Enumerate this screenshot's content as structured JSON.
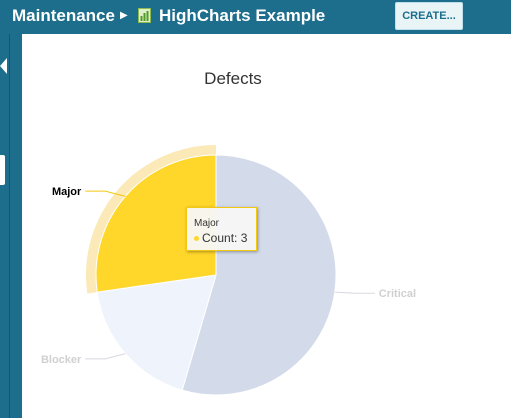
{
  "header": {
    "breadcrumb_root": "Maintenance",
    "breadcrumb_current": "HighCharts Example",
    "create_label": "CREATE..."
  },
  "icons": {
    "breadcrumb_separator": "caret-right-icon",
    "page": "chart-page-icon",
    "sidebar_toggle": "collapse-left-icon"
  },
  "colors": {
    "header_bg": "#1c6e8c",
    "critical": "#d3dbeb",
    "blocker": "#eff4fc",
    "major": "#ffd62a",
    "major_halo": "#fbe9b8"
  },
  "tooltip": {
    "title": "Major",
    "series_label": "Count",
    "value": "3"
  },
  "chart_data": {
    "type": "pie",
    "title": "Defects",
    "series": [
      {
        "name": "Count",
        "data": [
          {
            "label": "Critical",
            "value": 6
          },
          {
            "label": "Blocker",
            "value": 2
          },
          {
            "label": "Major",
            "value": 3
          }
        ]
      }
    ],
    "hovered": "Major",
    "legend": "none"
  }
}
